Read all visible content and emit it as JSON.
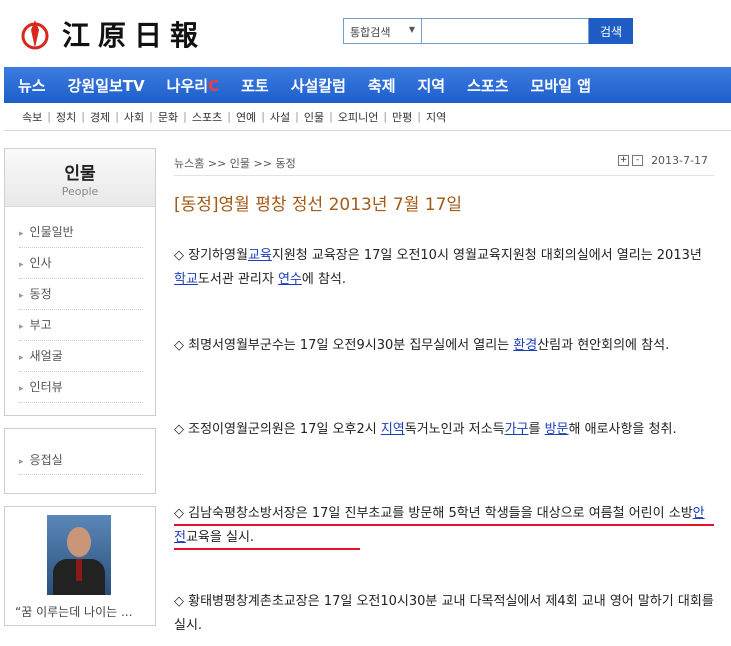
{
  "header": {
    "logo_text": "江原日報",
    "search": {
      "select_label": "통합검색",
      "input_value": "",
      "button_label": "검색"
    }
  },
  "main_nav": [
    {
      "label": "뉴스"
    },
    {
      "label": "강원일보TV"
    },
    {
      "label": "나우리",
      "accent": "C"
    },
    {
      "label": "포토"
    },
    {
      "label": "사설칼럼"
    },
    {
      "label": "축제"
    },
    {
      "label": "지역"
    },
    {
      "label": "스포츠"
    },
    {
      "label": "모바일 앱"
    }
  ],
  "sub_nav": [
    "속보",
    "정치",
    "경제",
    "사회",
    "문화",
    "스포츠",
    "연예",
    "사설",
    "인물",
    "오피니언",
    "만평",
    "지역"
  ],
  "sidebar": {
    "title": "인물",
    "subtitle": "People",
    "items": [
      "인물일반",
      "인사",
      "동정",
      "부고",
      "새얼굴",
      "인터뷰"
    ],
    "box2_item": "응접실",
    "caption": "“꿈 이루는데 나이는 ..."
  },
  "article": {
    "breadcrumb": "뉴스홈 >> 인물 >> 동정",
    "zoom_in": "+",
    "zoom_out": "-",
    "date": "2013-7-17",
    "title": "[동정]영월 평창 정선 2013년 7월 17일",
    "paragraphs": [
      [
        {
          "t": "◇ 장기하영월"
        },
        {
          "t": "교육",
          "link": true
        },
        {
          "t": "지원청 교육장은 17일 오전10시 영월교육지원청 대회의실에서 열리는 2013년 "
        },
        {
          "t": "학교",
          "link": true
        },
        {
          "t": "도서관 관리자 "
        },
        {
          "t": "연수",
          "link": true
        },
        {
          "t": "에 참석."
        }
      ],
      [
        {
          "t": "◇ 최명서영월부군수는 17일 오전9시30분 집무실에서 열리는 "
        },
        {
          "t": "환경",
          "link": true
        },
        {
          "t": "산림과 현안회의에 참석."
        }
      ],
      [
        {
          "t": "◇ 조정이영월군의원은 17일 오후2시 "
        },
        {
          "t": "지역",
          "link": true
        },
        {
          "t": "독거노인과 저소득"
        },
        {
          "t": "가구",
          "link": true
        },
        {
          "t": "를 "
        },
        {
          "t": "방문",
          "link": true
        },
        {
          "t": "해 애로사항을 청취."
        }
      ],
      [
        {
          "t": "◇ 김남숙평창소방서장은 17일 진부초교를 방문해 5학년 학생들을 대상으로 여름철 어린이 소방"
        },
        {
          "t": "안전",
          "link": true
        },
        {
          "t": "교육을 실시."
        }
      ],
      [
        {
          "t": "◇ 황태병평창계촌초교장은 17일 오전10시30분 교내 다목적실에서 제4회 교내 영어 말하기 대회를 실시."
        }
      ]
    ]
  },
  "colors": {
    "nav_blue": "#1d5fcc",
    "title_brown": "#a45a14",
    "link_blue": "#1c3fb6",
    "highlight_red": "#e3132a"
  }
}
